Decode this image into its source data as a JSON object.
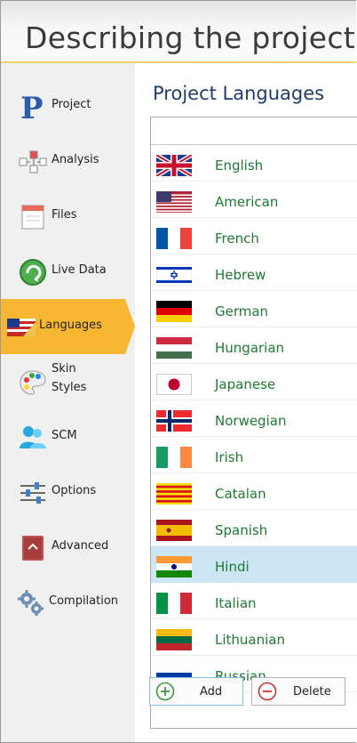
{
  "header": {
    "title": "Describing the project"
  },
  "sidebar": {
    "items": [
      {
        "label": "Project",
        "icon": "project-p-icon"
      },
      {
        "label": "Analysis",
        "icon": "analysis-icon"
      },
      {
        "label": "Files",
        "icon": "files-icon"
      },
      {
        "label": "Live Data",
        "icon": "live-data-icon"
      },
      {
        "label": "Languages",
        "icon": "languages-flag-icon",
        "selected": true
      },
      {
        "label": "Skin Styles",
        "icon": "palette-icon"
      },
      {
        "label": "SCM",
        "icon": "scm-users-icon"
      },
      {
        "label": "Options",
        "icon": "options-sliders-icon"
      },
      {
        "label": "Advanced",
        "icon": "advanced-book-icon"
      },
      {
        "label": "Compilation",
        "icon": "compilation-gears-icon"
      }
    ]
  },
  "content": {
    "title": "Project Languages",
    "languages": [
      {
        "name": "English",
        "flag": "uk"
      },
      {
        "name": "American",
        "flag": "us"
      },
      {
        "name": "French",
        "flag": "fr"
      },
      {
        "name": "Hebrew",
        "flag": "il"
      },
      {
        "name": "German",
        "flag": "de"
      },
      {
        "name": "Hungarian",
        "flag": "hu"
      },
      {
        "name": "Japanese",
        "flag": "jp"
      },
      {
        "name": "Norwegian",
        "flag": "no"
      },
      {
        "name": "Irish",
        "flag": "ie"
      },
      {
        "name": "Catalan",
        "flag": "cat"
      },
      {
        "name": "Spanish",
        "flag": "es"
      },
      {
        "name": "Hindi",
        "flag": "in",
        "selected": true
      },
      {
        "name": "Italian",
        "flag": "it"
      },
      {
        "name": "Lithuanian",
        "flag": "lt"
      },
      {
        "name": "Russian",
        "flag": "ru"
      }
    ]
  },
  "buttons": {
    "add_label": "Add",
    "delete_label": "Delete"
  },
  "colors": {
    "selected_nav": "#f7b733",
    "selected_row": "#cde6f3",
    "language_text": "#1e7a32",
    "title_text": "#1f3d6b",
    "header_accent": "#f0d070"
  }
}
